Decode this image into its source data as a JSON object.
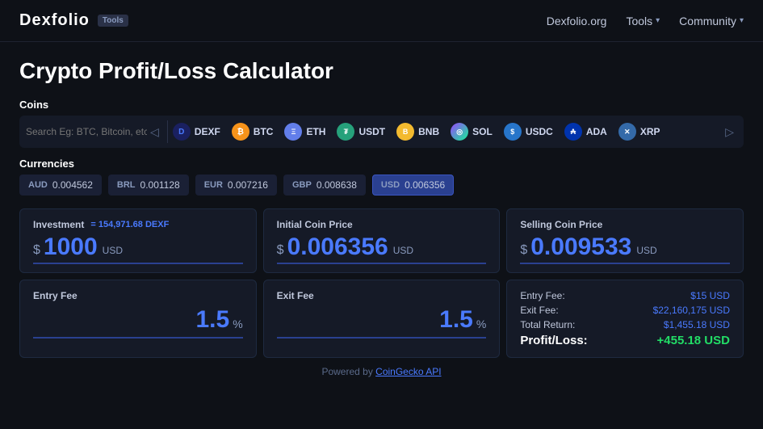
{
  "nav": {
    "logo": "Dexfolio",
    "tools_badge": "Tools",
    "links": [
      {
        "label": "Dexfolio.org",
        "has_chevron": false
      },
      {
        "label": "Tools",
        "has_chevron": true
      },
      {
        "label": "Community",
        "has_chevron": true
      }
    ]
  },
  "page": {
    "title": "Crypto Profit/Loss Calculator"
  },
  "coins": {
    "section_label": "Coins",
    "search_placeholder": "Search Eg: BTC, Bitcoin, etc.",
    "items": [
      {
        "symbol": "DEXF",
        "icon_text": "D",
        "icon_class": "icon-dexf"
      },
      {
        "symbol": "BTC",
        "icon_text": "₿",
        "icon_class": "icon-btc"
      },
      {
        "symbol": "ETH",
        "icon_text": "Ξ",
        "icon_class": "icon-eth"
      },
      {
        "symbol": "USDT",
        "icon_text": "₮",
        "icon_class": "icon-usdt"
      },
      {
        "symbol": "BNB",
        "icon_text": "B",
        "icon_class": "icon-bnb"
      },
      {
        "symbol": "SOL",
        "icon_text": "◎",
        "icon_class": "icon-sol"
      },
      {
        "symbol": "USDC",
        "icon_text": "$",
        "icon_class": "icon-usdc"
      },
      {
        "symbol": "ADA",
        "icon_text": "₳",
        "icon_class": "icon-ada"
      },
      {
        "symbol": "XRP",
        "icon_text": "✕",
        "icon_class": "icon-xrp"
      }
    ]
  },
  "currencies": {
    "section_label": "Currencies",
    "items": [
      {
        "code": "AUD",
        "value": "0.004562",
        "active": false
      },
      {
        "code": "BRL",
        "value": "0.001128",
        "active": false
      },
      {
        "code": "EUR",
        "value": "0.007216",
        "active": false
      },
      {
        "code": "GBP",
        "value": "0.008638",
        "active": false
      },
      {
        "code": "USD",
        "value": "0.006356",
        "active": true
      }
    ]
  },
  "calculator": {
    "investment": {
      "label": "Investment",
      "hint": "= 154,971.68 DEXF",
      "prefix": "$",
      "value": "1000",
      "unit": "USD"
    },
    "initial_price": {
      "label": "Initial Coin Price",
      "prefix": "$",
      "value": "0.006356",
      "unit": "USD"
    },
    "selling_price": {
      "label": "Selling Coin Price",
      "prefix": "$",
      "value": "0.009533",
      "unit": "USD"
    },
    "entry_fee": {
      "label": "Entry Fee",
      "value": "1.5",
      "unit": "%"
    },
    "exit_fee": {
      "label": "Exit Fee",
      "value": "1.5",
      "unit": "%"
    },
    "summary": {
      "entry_fee_label": "Entry Fee:",
      "entry_fee_value": "$15 USD",
      "exit_fee_label": "Exit Fee:",
      "exit_fee_value": "$22,160,175 USD",
      "total_return_label": "Total Return:",
      "total_return_value": "$1,455.18 USD",
      "pnl_label": "Profit/Loss:",
      "pnl_value": "+455.18 USD"
    }
  },
  "footer": {
    "text": "Powered by ",
    "link": "CoinGecko API"
  }
}
